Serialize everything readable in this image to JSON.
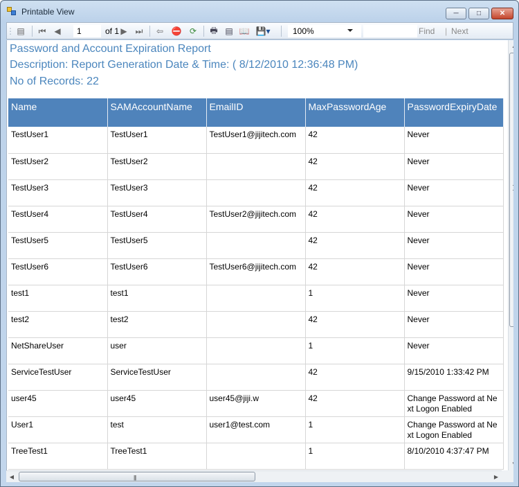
{
  "window": {
    "title": "Printable View"
  },
  "toolbar": {
    "current_page": "1",
    "of_label": "of",
    "total_pages": "1",
    "zoom": "100%",
    "find_label": "Find",
    "separator": "|",
    "next_label": "Next"
  },
  "report": {
    "title": "Password and Account Expiration Report",
    "description": "Description: Report Generation Date & Time: ( 8/12/2010 12:36:48 PM)",
    "record_count": "No of Records: 22"
  },
  "table": {
    "headers": [
      "Name",
      "SAMAccountName",
      "EmailID",
      "MaxPasswordAge",
      "PasswordExpiryDate"
    ],
    "rows": [
      [
        "TestUser1",
        "TestUser1",
        "TestUser1@jijitech.com",
        "42",
        "Never"
      ],
      [
        "TestUser2",
        "TestUser2",
        "",
        "42",
        "Never"
      ],
      [
        "TestUser3",
        "TestUser3",
        "",
        "42",
        "Never"
      ],
      [
        "TestUser4",
        "TestUser4",
        "TestUser2@jijitech.com",
        "42",
        "Never"
      ],
      [
        "TestUser5",
        "TestUser5",
        "",
        "42",
        "Never"
      ],
      [
        "TestUser6",
        "TestUser6",
        "TestUser6@jijitech.com",
        "42",
        "Never"
      ],
      [
        "test1",
        "test1",
        "",
        "1",
        "Never"
      ],
      [
        "test2",
        "test2",
        "",
        "42",
        "Never"
      ],
      [
        "NetShareUser",
        "user",
        "",
        "1",
        "Never"
      ],
      [
        "ServiceTestUser",
        "ServiceTestUser",
        "",
        "42",
        "9/15/2010 1:33:42 PM"
      ],
      [
        "user45",
        "user45",
        "user45@jiji.w",
        "42",
        "Change Password at Next Logon Enabled"
      ],
      [
        "User1",
        "test",
        "user1@test.com",
        "1",
        "Change Password at Next Logon Enabled"
      ],
      [
        "TreeTest1",
        "TreeTest1",
        "",
        "1",
        "8/10/2010 4:37:47 PM"
      ]
    ]
  },
  "colors": {
    "header_bg": "#4f83bb",
    "accent_text": "#4b86bd"
  }
}
